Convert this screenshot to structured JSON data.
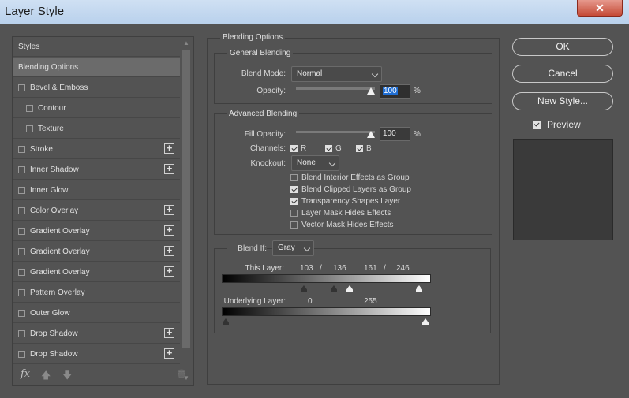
{
  "window": {
    "title": "Layer Style",
    "close_glyph": "✕"
  },
  "left_panel": {
    "items": [
      {
        "label": "Styles",
        "checkbox": false,
        "checked": false,
        "indent": 0,
        "plus": false,
        "selected": false
      },
      {
        "label": "Blending Options",
        "checkbox": false,
        "checked": false,
        "indent": 0,
        "plus": false,
        "selected": true
      },
      {
        "label": "Bevel & Emboss",
        "checkbox": true,
        "checked": false,
        "indent": 0,
        "plus": false,
        "selected": false
      },
      {
        "label": "Contour",
        "checkbox": true,
        "checked": false,
        "indent": 1,
        "plus": false,
        "selected": false
      },
      {
        "label": "Texture",
        "checkbox": true,
        "checked": false,
        "indent": 1,
        "plus": false,
        "selected": false
      },
      {
        "label": "Stroke",
        "checkbox": true,
        "checked": false,
        "indent": 0,
        "plus": true,
        "selected": false
      },
      {
        "label": "Inner Shadow",
        "checkbox": true,
        "checked": false,
        "indent": 0,
        "plus": true,
        "selected": false
      },
      {
        "label": "Inner Glow",
        "checkbox": true,
        "checked": false,
        "indent": 0,
        "plus": false,
        "selected": false
      },
      {
        "label": "Color Overlay",
        "checkbox": true,
        "checked": false,
        "indent": 0,
        "plus": true,
        "selected": false
      },
      {
        "label": "Gradient Overlay",
        "checkbox": true,
        "checked": false,
        "indent": 0,
        "plus": true,
        "selected": false
      },
      {
        "label": "Gradient Overlay",
        "checkbox": true,
        "checked": false,
        "indent": 0,
        "plus": true,
        "selected": false
      },
      {
        "label": "Gradient Overlay",
        "checkbox": true,
        "checked": false,
        "indent": 0,
        "plus": true,
        "selected": false
      },
      {
        "label": "Pattern Overlay",
        "checkbox": true,
        "checked": false,
        "indent": 0,
        "plus": false,
        "selected": false
      },
      {
        "label": "Outer Glow",
        "checkbox": true,
        "checked": false,
        "indent": 0,
        "plus": false,
        "selected": false
      },
      {
        "label": "Drop Shadow",
        "checkbox": true,
        "checked": false,
        "indent": 0,
        "plus": true,
        "selected": false
      },
      {
        "label": "Drop Shadow",
        "checkbox": true,
        "checked": false,
        "indent": 0,
        "plus": true,
        "selected": false
      }
    ],
    "bottom": {
      "fx_label": "fx",
      "up_glyph": "🡅",
      "down_glyph": "🡇",
      "trash_glyph": "🗑"
    }
  },
  "blending_options": {
    "title": "Blending Options",
    "general": {
      "title": "General Blending",
      "blend_mode_label": "Blend Mode:",
      "blend_mode_value": "Normal",
      "opacity_label": "Opacity:",
      "opacity_value": "100",
      "opacity_unit": "%",
      "opacity_fraction": 1.0
    },
    "advanced": {
      "title": "Advanced Blending",
      "fill_opacity_label": "Fill Opacity:",
      "fill_opacity_value": "100",
      "fill_opacity_unit": "%",
      "fill_opacity_fraction": 1.0,
      "channels_label": "Channels:",
      "channels": [
        {
          "label": "R",
          "checked": true
        },
        {
          "label": "G",
          "checked": true
        },
        {
          "label": "B",
          "checked": true
        }
      ],
      "knockout_label": "Knockout:",
      "knockout_value": "None",
      "options": [
        {
          "label": "Blend Interior Effects as Group",
          "checked": false
        },
        {
          "label": "Blend Clipped Layers as Group",
          "checked": true
        },
        {
          "label": "Transparency Shapes Layer",
          "checked": true
        },
        {
          "label": "Layer Mask Hides Effects",
          "checked": false
        },
        {
          "label": "Vector Mask Hides Effects",
          "checked": false
        }
      ]
    },
    "blend_if": {
      "label": "Blend If:",
      "value": "Gray",
      "this_layer_label": "This Layer:",
      "this_layer_values": [
        "103",
        "/",
        "136",
        "161",
        "/",
        "246"
      ],
      "underlying_label": "Underlying Layer:",
      "underlying_values": [
        "0",
        "255"
      ]
    }
  },
  "buttons": {
    "ok": "OK",
    "cancel": "Cancel",
    "new_style": "New Style...",
    "preview_label": "Preview",
    "preview_checked": true
  }
}
